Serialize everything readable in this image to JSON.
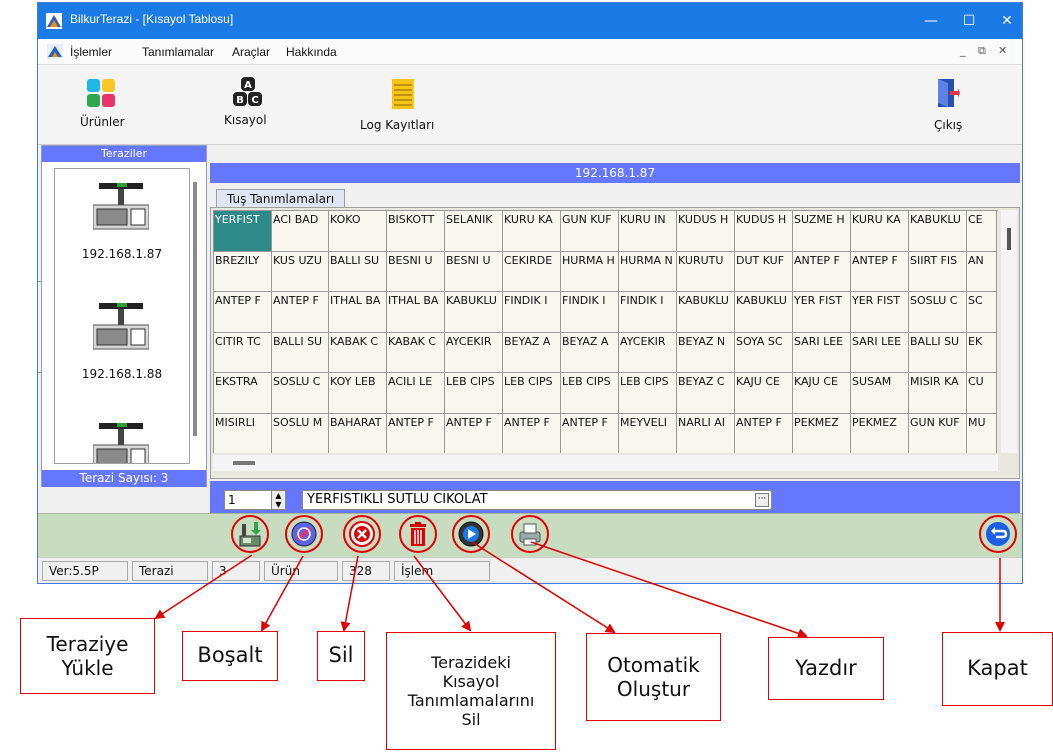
{
  "window": {
    "title": "BilkurTerazi  - [Kısayol Tablosu]",
    "minimize": "—",
    "maximize": "☐",
    "close": "✕"
  },
  "menu": {
    "items": [
      "İşlemler",
      "Tanımlamalar",
      "Araçlar",
      "Hakkında"
    ],
    "mdi_controls": [
      "_",
      "⧉",
      "✕"
    ]
  },
  "toolbar": {
    "urunler": "Ürünler",
    "kisayol": "Kısayol",
    "log": "Log Kayıtları",
    "cikis": "Çıkış"
  },
  "scales": {
    "header": "Teraziler",
    "items": [
      {
        "ip": "192.168.1.87"
      },
      {
        "ip": "192.168.1.88"
      },
      {
        "ip": ""
      }
    ],
    "count_label": "Terazi Sayısı: 3"
  },
  "main": {
    "ip": "192.168.1.87",
    "tab": "Tuş Tanımlamaları",
    "grid": [
      [
        "YERFIST",
        "ACI BAD",
        "KOKO",
        "BISKOTT",
        "SELANIK",
        "KURU KA",
        "GUN KUF",
        "KURU IN",
        "KUDUS H",
        "KUDUS H",
        "SUZME H",
        "KURU KA",
        "KABUKLU",
        "CE"
      ],
      [
        "BREZILY",
        "KUS UZU",
        "BALLI SU",
        "BESNI U",
        "BESNI U",
        "CEKIRDE",
        "HURMA H",
        "HURMA N",
        "KURUTU",
        "DUT KUF",
        "ANTEP F",
        "ANTEP F",
        "SIIRT FIS",
        "AN"
      ],
      [
        "ANTEP F",
        "ANTEP F",
        "ITHAL BA",
        "ITHAL BA",
        "KABUKLU",
        "FINDIK I",
        "FINDIK I",
        "FINDIK I",
        "KABUKLU",
        "KABUKLU",
        "YER FIST",
        "YER FIST",
        "SOSLU C",
        "SC"
      ],
      [
        "CITIR TC",
        "BALLI SU",
        "KABAK C",
        "KABAK C",
        "AYCEKIR",
        "BEYAZ A",
        "BEYAZ A",
        "AYCEKIR",
        "BEYAZ N",
        "SOYA SC",
        "SARI LEE",
        "SARI LEE",
        "BALLI SU",
        "EK"
      ],
      [
        "EKSTRA",
        "SOSLU C",
        "KOY LEB",
        "ACILI LE",
        "LEB CIPS",
        "LEB CIPS",
        "LEB CIPS",
        "LEB CIPS",
        "BEYAZ C",
        "KAJU CE",
        "KAJU CE",
        "SUSAM",
        "MISIR KA",
        "CU"
      ],
      [
        "MISIRLI",
        "SOSLU M",
        "BAHARAT",
        "ANTEP F",
        "ANTEP F",
        "ANTEP F",
        "ANTEP F",
        "MEYVELI",
        "NARLI AI",
        "ANTEP F",
        "PEKMEZ",
        "PEKMEZ",
        "GUN KUF",
        "MU"
      ]
    ],
    "spin_value": "1",
    "product_value": "YERFISTIKLI SUTLU CIKOLAT",
    "dots": "···"
  },
  "status": {
    "version": "Ver:5.5P",
    "terazi_label": "Terazi",
    "terazi_count": "3",
    "urun_label": "Ürün",
    "urun_count": "328",
    "islem_label": "İşlem"
  },
  "callouts": {
    "teraziye_yukle": "Teraziye\nYükle",
    "bosalt": "Boşalt",
    "sil": "Sil",
    "terazideki": "Terazideki\nKısayol\nTanımlamalarını\nSil",
    "otomatik": "Otomatik\nOluştur",
    "yazdir": "Yazdır",
    "kapat": "Kapat"
  },
  "colors": {
    "titlebar": "#1a7ae6",
    "header_blue": "#6677ff",
    "selected_cell": "#2e8a88",
    "callout_red": "#e00000",
    "action_bar": "#c8dcc0"
  },
  "icons": {
    "toolbar": [
      "products-icon",
      "shortcut-abc-icon",
      "log-records-icon",
      "exit-door-icon"
    ],
    "actions": [
      "upload-to-scale-icon",
      "empty-icon",
      "delete-icon",
      "trash-icon",
      "auto-generate-icon",
      "print-icon",
      "back-close-icon"
    ]
  }
}
